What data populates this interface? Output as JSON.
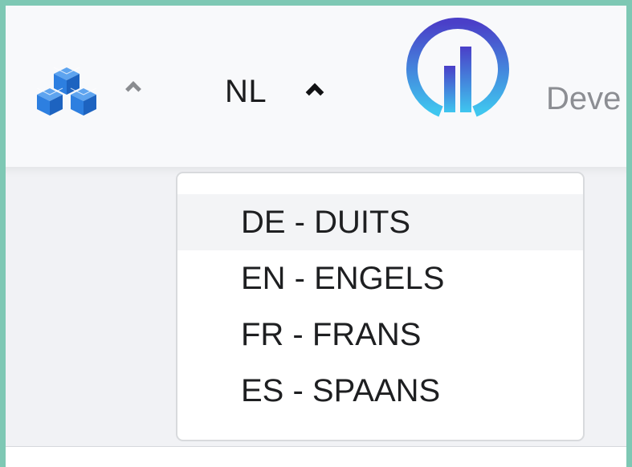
{
  "header": {
    "apps_icon": "cubes-icon",
    "apps_chevron_icon": "chevron-up-icon",
    "language": {
      "current": "NL",
      "chevron_icon": "chevron-up-icon"
    },
    "logo_icon": "bar-chart-circle-logo",
    "brand_text": "Deve"
  },
  "language_menu": {
    "items": [
      {
        "label": "DE - DUITS",
        "highlighted": true
      },
      {
        "label": "EN - ENGELS",
        "highlighted": false
      },
      {
        "label": "FR - FRANS",
        "highlighted": false
      },
      {
        "label": "ES - SPAANS",
        "highlighted": false
      }
    ]
  },
  "colors": {
    "frame_border": "#7ec8b4",
    "apps_icon_blue": "#2d7fe0",
    "logo_gradient_top": "#4a3fc8",
    "logo_gradient_bottom": "#3fc6ef",
    "header_bg": "#f8f9fb",
    "content_bg": "#f1f2f5"
  }
}
